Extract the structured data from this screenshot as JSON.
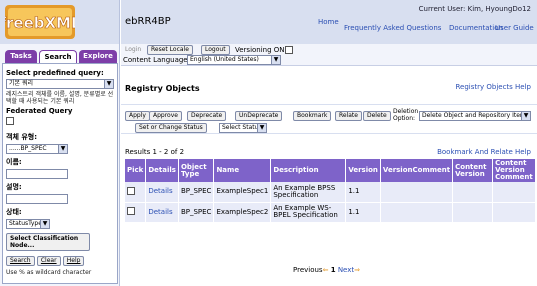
{
  "app": {
    "title": "ebRR4BP",
    "user": "Current User: Kim, HyoungDo12"
  },
  "top_links": [
    "Home",
    "Frequently Asked Questions",
    "Documentation",
    "User Guide"
  ],
  "logo": {
    "text": "freebXML"
  },
  "tabs": [
    "Tasks",
    "Search",
    "Explore"
  ],
  "left": {
    "select_query_label": "Select predefined query:",
    "select_query_value": "기본 쿼리",
    "query_help": "레지스트리 객체를 이름, 설명, 분류별로 선택할 때 사용되는 기본 쿼리",
    "federated_label": "Federated Query",
    "object_type_label": "객체 유형:",
    "object_type_value": "......BP_SPEC",
    "name_label": "이름:",
    "desc_label": "설명:",
    "status_label": "상태:",
    "status_value": "StatusType",
    "classification_button": "Select Classification Node...",
    "search_button": "Search",
    "clear_button": "Clear",
    "help_button": "Help",
    "wildcard_hint": "Use % as wildcard character"
  },
  "toolbar": {
    "login": "Login",
    "reset_locale": "Reset Locale",
    "logout": "Logout",
    "versioning": "Versioning ON",
    "content_language_label": "Content Language:",
    "content_language_value": "English (United States)"
  },
  "main": {
    "section_title": "Registry Objects",
    "help_link": "Registry Objects Help",
    "actions": [
      "Apply",
      "Approve",
      "Deprecate",
      "UnDeprecate",
      "Bookmark",
      "Relate",
      "Delete"
    ],
    "deletion_option_label": "Deletion Option:",
    "deletion_option_value": "Delete Object and Repository Item",
    "set_status_button": "Set or Change Status",
    "select_status_value": "Select Status",
    "results_label": "Results 1 - 2 of 2",
    "bookmark_help": "Bookmark And Relate Help",
    "columns": [
      "Pick",
      "Details",
      "Object Type",
      "Name",
      "Description",
      "Version",
      "VersionComment",
      "Content Version",
      "Content Version Comment"
    ],
    "rows": [
      {
        "details": "Details",
        "type": "BP_SPEC",
        "name": "ExampleSpec1",
        "description": "An Example BPSS Specification",
        "version": "1.1",
        "vcomment": "",
        "cversion": "",
        "cvcomment": ""
      },
      {
        "details": "Details",
        "type": "BP_SPEC",
        "name": "ExampleSpec2",
        "description": "An Example WS-BPEL Specification",
        "version": "1.1",
        "vcomment": "",
        "cversion": "",
        "cvcomment": ""
      }
    ],
    "pager": {
      "prev": "Previous",
      "page": "1",
      "next": "Next"
    }
  },
  "colors": {
    "header_bg": "#d8dff0",
    "table_header": "#7e63c9",
    "tab_purple": "#7d3ea8",
    "link": "#2b4fb3"
  }
}
